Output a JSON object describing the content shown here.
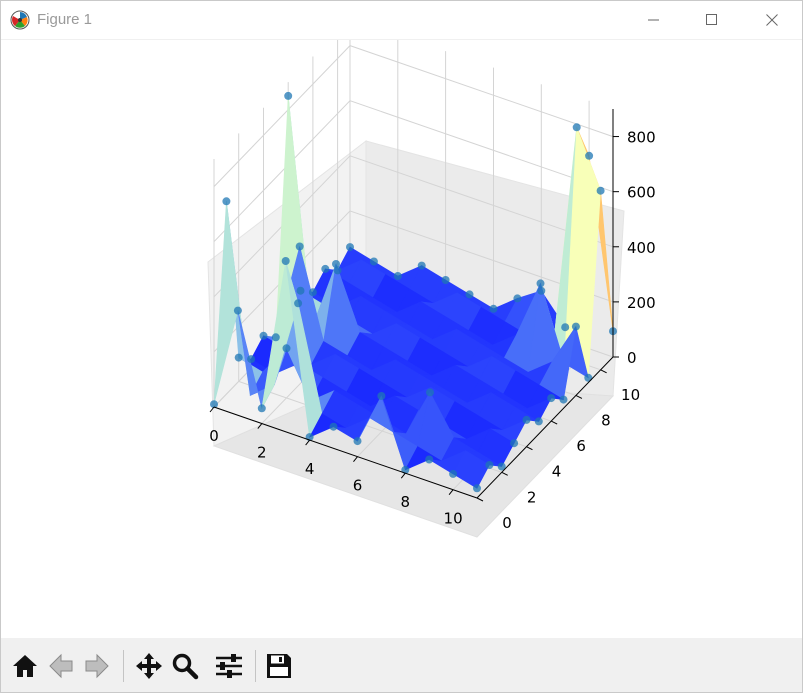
{
  "window": {
    "title": "Figure 1"
  },
  "toolbar": {
    "buttons": [
      {
        "icon": "home-icon"
      },
      {
        "icon": "back-arrow-icon"
      },
      {
        "icon": "forward-arrow-icon"
      },
      {
        "icon": "pan-icon"
      },
      {
        "icon": "zoom-icon"
      },
      {
        "icon": "configure-subplots-icon"
      },
      {
        "icon": "save-icon"
      }
    ]
  },
  "chart_data": {
    "type": "surface",
    "title": "",
    "x_ticks": [
      "0",
      "2",
      "4",
      "6",
      "8",
      "10"
    ],
    "y_ticks": [
      "0",
      "2",
      "4",
      "6",
      "8",
      "10"
    ],
    "z_ticks": [
      "0",
      "200",
      "400",
      "600",
      "800"
    ],
    "xlim": [
      0,
      11
    ],
    "ylim": [
      0,
      11
    ],
    "zlim": [
      0,
      900
    ],
    "colormap": "rainbow",
    "scatter_color": "#1f77b4",
    "grid": true,
    "notes": "Surface with tall spikes near the corners (up to ~800) and a low flat region (~0-100) in the middle; scatter points overlaid."
  }
}
